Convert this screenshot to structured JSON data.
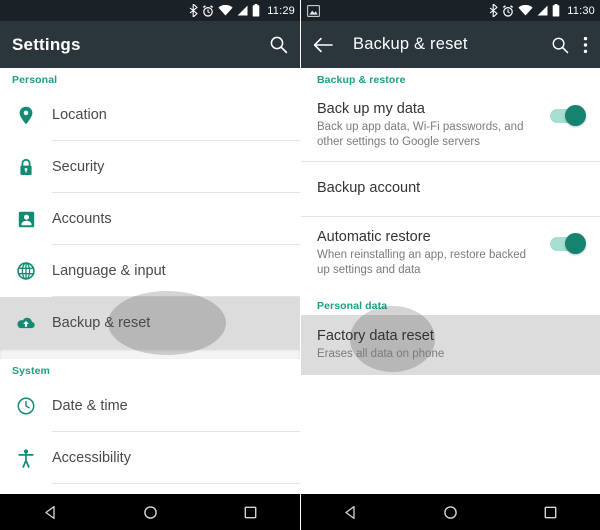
{
  "left": {
    "status_bar": {
      "icons": [
        "bluetooth-icon",
        "alarm-icon",
        "wifi-icon",
        "signal-icon",
        "battery-icon"
      ],
      "time": "11:29"
    },
    "toolbar": {
      "title": "Settings",
      "search_icon": "search-icon"
    },
    "sections": [
      {
        "header": "Personal",
        "items": [
          {
            "label": "Location",
            "icon": "location-pin-icon",
            "selected": false
          },
          {
            "label": "Security",
            "icon": "lock-icon",
            "selected": false
          },
          {
            "label": "Accounts",
            "icon": "account-box-icon",
            "selected": false
          },
          {
            "label": "Language & input",
            "icon": "globe-icon",
            "selected": false
          },
          {
            "label": "Backup & reset",
            "icon": "cloud-upload-icon",
            "selected": true
          }
        ]
      },
      {
        "header": "System",
        "items": [
          {
            "label": "Date & time",
            "icon": "clock-icon",
            "selected": false
          },
          {
            "label": "Accessibility",
            "icon": "accessibility-icon",
            "selected": false
          }
        ]
      }
    ],
    "nav_bar": [
      "back-icon",
      "home-icon",
      "recents-icon"
    ]
  },
  "right": {
    "status_bar": {
      "notification_icon": "screenshot-icon",
      "icons": [
        "bluetooth-icon",
        "alarm-icon",
        "wifi-icon",
        "signal-icon",
        "battery-icon"
      ],
      "time": "11:30"
    },
    "toolbar": {
      "back_icon": "arrow-back-icon",
      "title": "Backup & reset",
      "search_icon": "search-icon",
      "overflow_icon": "more-vert-icon"
    },
    "sections": [
      {
        "header": "Backup & restore",
        "items": [
          {
            "title": "Back up my data",
            "subtitle": "Back up app data, Wi-Fi passwords, and other settings to Google servers",
            "toggle": "on",
            "selected": false
          },
          {
            "title": "Backup account",
            "subtitle": "",
            "toggle": "none",
            "selected": false
          },
          {
            "title": "Automatic restore",
            "subtitle": "When reinstalling an app, restore backed up settings and data",
            "toggle": "on",
            "selected": false
          }
        ]
      },
      {
        "header": "Personal data",
        "items": [
          {
            "title": "Factory data reset",
            "subtitle": "Erases all data on phone",
            "toggle": "none",
            "selected": true
          }
        ]
      }
    ],
    "nav_bar": [
      "back-icon",
      "home-icon",
      "recents-icon"
    ]
  },
  "colors": {
    "accent": "#1aa085",
    "toolbar": "#2b353c",
    "status_bar": "#1b2227",
    "selected_row": "#dcdcdc",
    "toggle_on": "#148370"
  }
}
